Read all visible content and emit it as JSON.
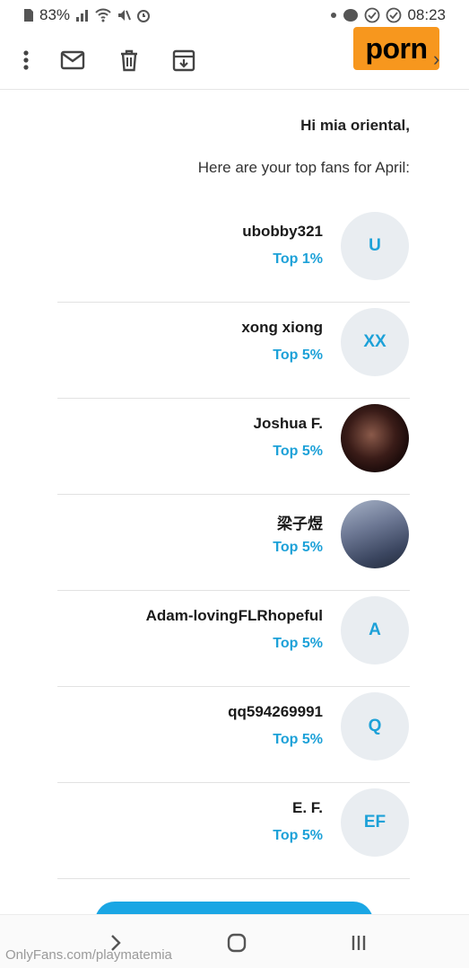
{
  "status_bar": {
    "time": "08:23",
    "battery": "83%"
  },
  "toolbar": {
    "brand_text": "porn",
    "icons": [
      "more-vert-icon",
      "mail-icon",
      "trash-icon",
      "archive-icon",
      "chevron-right-icon"
    ]
  },
  "email": {
    "greeting": "Hi mia oriental,",
    "intro": "Here are your top fans for April:"
  },
  "fans": [
    {
      "initials": "U",
      "name": "ubobby321",
      "rank": "Top 1%",
      "photo": false
    },
    {
      "initials": "XX",
      "name": "xong xiong",
      "rank": "Top 5%",
      "photo": false
    },
    {
      "initials": "",
      "name": "Joshua F.",
      "rank": "Top 5%",
      "photo": true
    },
    {
      "initials": "",
      "name": "梁子煜",
      "rank": "Top 5%",
      "photo": true
    },
    {
      "initials": "A",
      "name": "Adam-lovingFLRhopeful",
      "rank": "Top 5%",
      "photo": false
    },
    {
      "initials": "Q",
      "name": "qq594269991",
      "rank": "Top 5%",
      "photo": false
    },
    {
      "initials": "EF",
      "name": "E. F.",
      "rank": "Top 5%",
      "photo": false
    }
  ],
  "watermark": "OnlyFans.com/playmatemia",
  "colors": {
    "accent": "#1da1d8",
    "brand_bg": "#f7971e",
    "avatar_bg": "#e9edf1"
  }
}
